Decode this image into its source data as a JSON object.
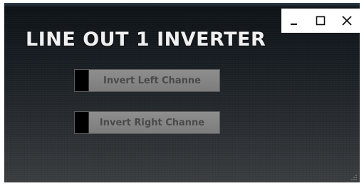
{
  "window": {
    "controls": [
      {
        "name": "minimize-button",
        "icon": "minimize-icon"
      },
      {
        "name": "maximize-button",
        "icon": "maximize-icon"
      },
      {
        "name": "close-button",
        "icon": "close-icon"
      }
    ]
  },
  "plugin": {
    "title": "LINE OUT 1 INVERTER",
    "buttons": {
      "invert_left_label": "Invert  Left Channe",
      "invert_right_label": "Invert  Right Channe"
    },
    "states": {
      "invert_left": false,
      "invert_right": false
    }
  },
  "colors": {
    "background_top": "#0e1317",
    "background_bottom": "#3b3e40",
    "title": "#f0f0f0",
    "button_face": "#8e8e8e",
    "button_text": "#4a4a4a",
    "led_off": "#000000"
  }
}
